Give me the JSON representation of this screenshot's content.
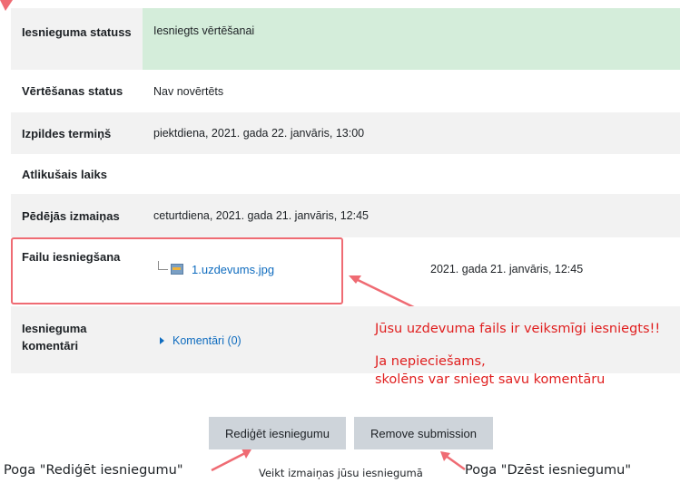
{
  "rows": {
    "submission_status": {
      "label": "Iesnieguma statuss",
      "value": "Iesniegts vērtēšanai"
    },
    "grading_status": {
      "label": "Vērtēšanas status",
      "value": "Nav novērtēts"
    },
    "due_date": {
      "label": "Izpildes termiņš",
      "value": "piektdiena, 2021. gada 22. janvāris, 13:00"
    },
    "time_remaining": {
      "label": "Atlikušais laiks",
      "value": ""
    },
    "last_modified": {
      "label": "Pēdējās izmaiņas",
      "value": "ceturtdiena, 2021. gada 21. janvāris, 12:45"
    },
    "file_submission": {
      "label": "Failu iesniegšana",
      "file_name": "1.uzdevums.jpg",
      "file_date": "2021. gada 21. janvāris, 12:45"
    },
    "submission_comments": {
      "label": "Iesnieguma komentāri",
      "comments_link": "Komentāri (0)"
    }
  },
  "annotations": {
    "file_success": "Jūsu uzdevuma fails ir veiksmīgi iesniegts!!",
    "comment_hint_line1": "Ja nepieciešams,",
    "comment_hint_line2": "skolēns var sniegt savu komentāru",
    "edit_hint": "Poga \"Rediģēt iesniegumu\"",
    "edit_sub_hint": "Veikt izmaiņas jūsu iesniegumā",
    "delete_hint": "Poga \"Dzēst iesniegumu\""
  },
  "buttons": {
    "edit": "Rediģēt iesniegumu",
    "remove": "Remove submission"
  },
  "colors": {
    "annotation_red": "#e01e1e",
    "arrow": "#ef6b73",
    "status_green": "#d4edda",
    "link": "#0f6cbf"
  }
}
